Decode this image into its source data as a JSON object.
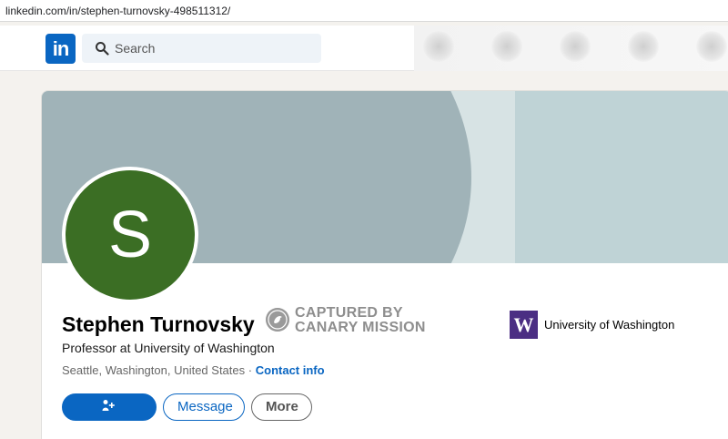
{
  "browser": {
    "url": "linkedin.com/in/stephen-turnovsky-498511312/"
  },
  "nav": {
    "logo": "in",
    "search_placeholder": "Search"
  },
  "profile": {
    "avatar_letter": "S",
    "name": "Stephen Turnovsky",
    "headline": "Professor at University of Washington",
    "location": "Seattle, Washington, United States",
    "separator": "·",
    "contact_info": "Contact info",
    "school": {
      "logo_letter": "W",
      "name": "University of Washington"
    }
  },
  "stamp": {
    "line1": "CAPTURED BY",
    "line2": "CANARY MISSION"
  },
  "actions": {
    "connect": "Connect",
    "message": "Message",
    "more": "More"
  },
  "colors": {
    "accent": "#0a66c2",
    "avatar_bg": "#3b6e24",
    "school_purple": "#4b2e83"
  }
}
